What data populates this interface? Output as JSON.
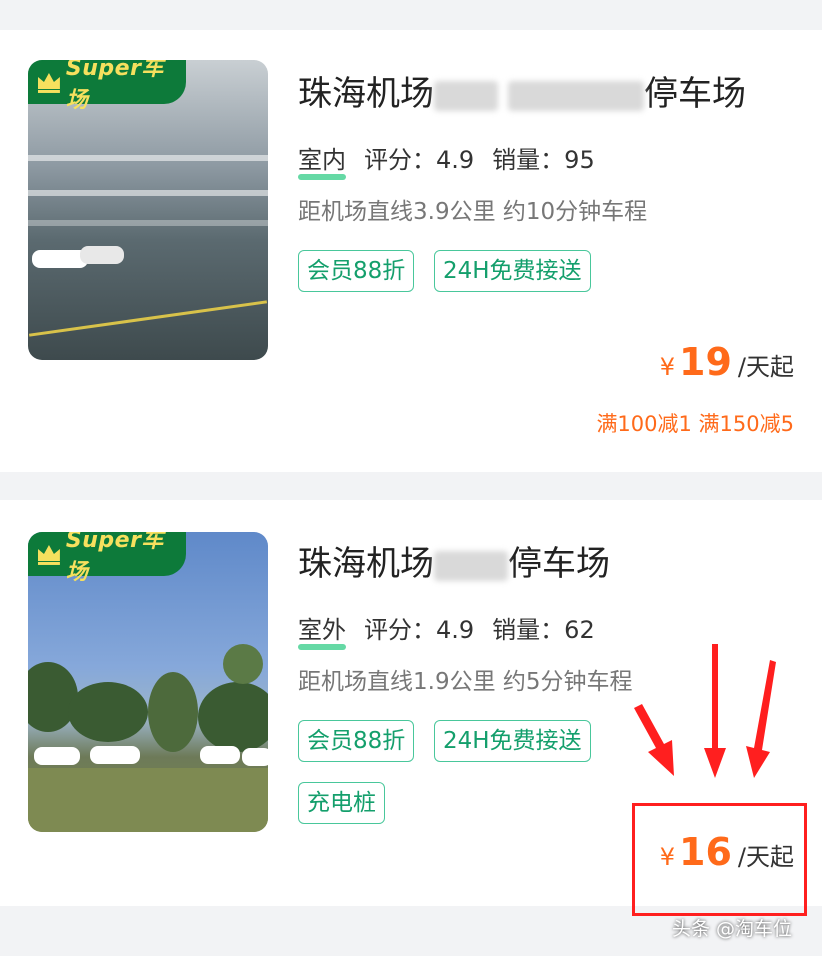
{
  "badge_label": "Super车场",
  "listings": [
    {
      "title_start": "珠海机场",
      "title_end": "停车场",
      "type": "室内",
      "rating_label": "评分：4.9",
      "sales_label": "销量：95",
      "distance": "距机场直线3.9公里 约10分钟车程",
      "tags": [
        "会员88折",
        "24H免费接送"
      ],
      "price_currency": "¥",
      "price_value": "19",
      "price_unit": "/天起",
      "promo": "满100减1 满150减5"
    },
    {
      "title_start": "珠海机场",
      "title_end": "停车场",
      "type": "室外",
      "rating_label": "评分：4.9",
      "sales_label": "销量：62",
      "distance": "距机场直线1.9公里 约5分钟车程",
      "tags": [
        "会员88折",
        "24H免费接送",
        "充电桩"
      ],
      "price_currency": "¥",
      "price_value": "16",
      "price_unit": "/天起"
    }
  ],
  "watermark": "头条 @淘车位",
  "colors": {
    "accent_orange": "#ff6a1a",
    "tag_green": "#149f6c",
    "badge_green": "#0d7a3a",
    "highlight_red": "#ff1f1f"
  }
}
